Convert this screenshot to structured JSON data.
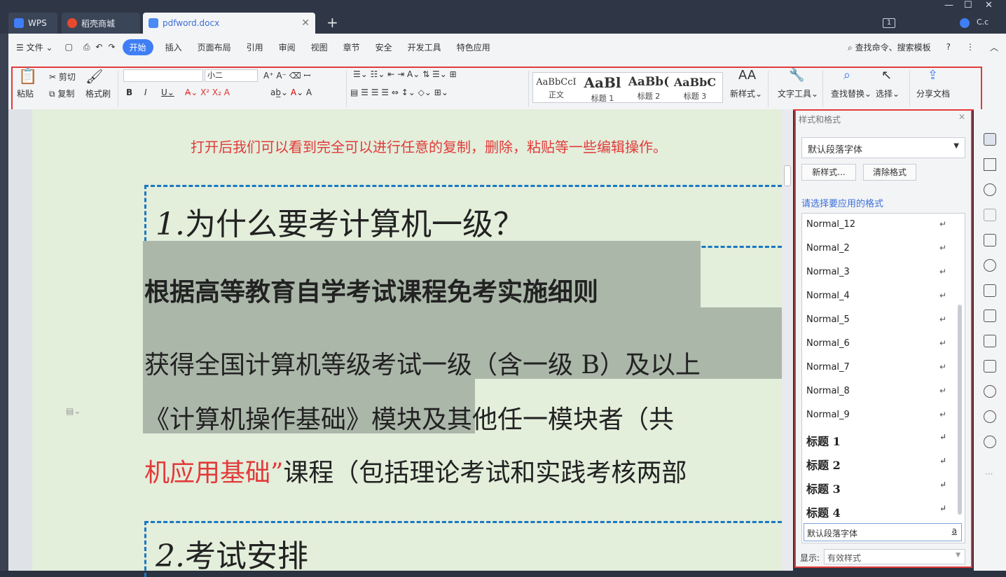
{
  "tabs": {
    "wps": "WPS",
    "store": "稻壳商城",
    "doc": "pdfword.docx"
  },
  "user": "C.c",
  "badge": "1",
  "menu": {
    "file": "文件",
    "items": [
      "开始",
      "插入",
      "页面布局",
      "引用",
      "审阅",
      "视图",
      "章节",
      "安全",
      "开发工具",
      "特色应用"
    ],
    "search": "查找命令、搜索模板"
  },
  "ribbon": {
    "paste": "粘贴",
    "cut": "剪切",
    "copy": "复制",
    "format_painter": "格式刷",
    "font_size": "小二",
    "styles": [
      {
        "preview": "AaBbCcI",
        "label": "正文"
      },
      {
        "preview": "AaBl",
        "label": "标题 1"
      },
      {
        "preview": "AaBb(",
        "label": "标题 2"
      },
      {
        "preview": "AaBbC",
        "label": "标题 3"
      }
    ],
    "new_style": "新样式",
    "text_tools": "文字工具",
    "find_replace": "查找替换",
    "select": "选择",
    "share": "分享文档"
  },
  "doc": {
    "red_note": "打开后我们可以看到完全可以进行任意的复制，删除，粘贴等一些编辑操作。",
    "h1_num": "1.",
    "h1_text": "为什么要考计算机一级？",
    "line1": "根据高等教育自学考试课程免考实施细则",
    "line2": "获得全国计算机等级考试一级（含一级 B）及以上",
    "line3a": "《计算机操作基础》模块",
    "line3b": "及其他任一模块者（共",
    "line4a": "机应用基础”",
    "line4b": "课程（包括理论考试和实践考核两部",
    "h2_num": "2.",
    "h2_text": "考试安排"
  },
  "panel": {
    "title": "样式和格式",
    "current": "默认段落字体",
    "new_btn": "新样式...",
    "clear_btn": "清除格式",
    "select_label": "请选择要应用的格式",
    "items": [
      "Normal_12",
      "Normal_2",
      "Normal_3",
      "Normal_4",
      "Normal_5",
      "Normal_6",
      "Normal_7",
      "Normal_8",
      "Normal_9"
    ],
    "headings": [
      "标题 1",
      "标题 2",
      "标题 3",
      "标题 4"
    ],
    "selected": "默认段落字体",
    "show_label": "显示:",
    "show_value": "有效样式"
  }
}
